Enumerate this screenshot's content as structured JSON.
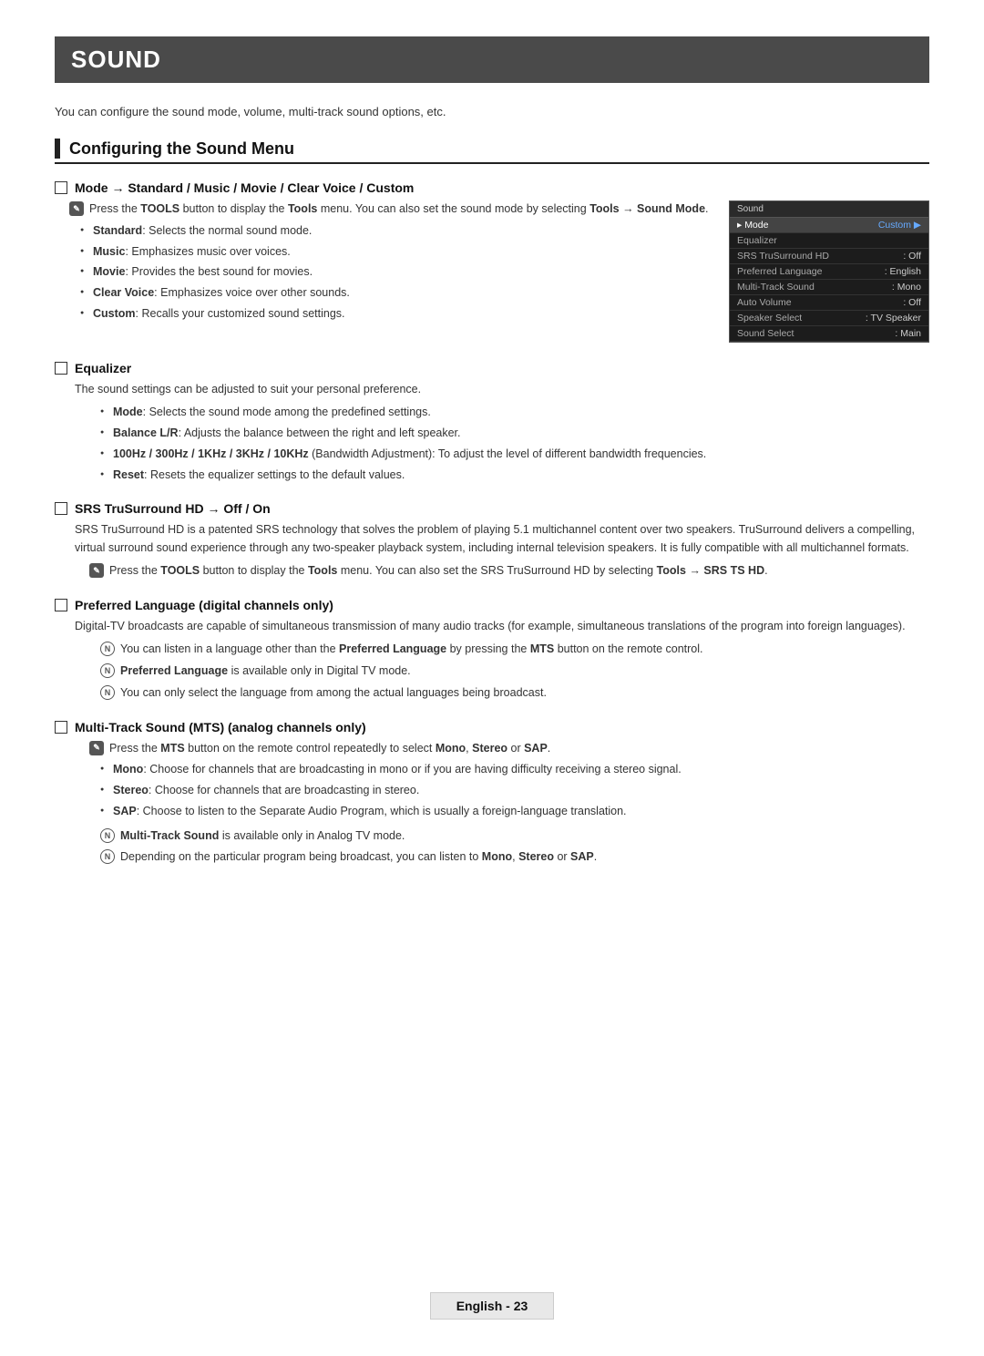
{
  "page": {
    "title": "SOUND",
    "intro": "You can configure the sound mode, volume, multi-track sound options, etc.",
    "section_title": "Configuring the Sound Menu",
    "footer_label": "English - 23"
  },
  "subsections": [
    {
      "id": "mode",
      "title": "Mode → Standard / Music / Movie / Clear Voice / Custom",
      "note1": "Press the TOOLS button to display the Tools menu. You can also set the sound mode by selecting Tools → Sound Mode.",
      "bullets": [
        "Standard: Selects the normal sound mode.",
        "Music: Emphasizes music over voices.",
        "Movie: Provides the best sound for movies.",
        "Clear Voice: Emphasizes voice over other sounds.",
        "Custom: Recalls your customized sound settings."
      ]
    },
    {
      "id": "equalizer",
      "title": "Equalizer",
      "body": "The sound settings can be adjusted to suit your personal preference.",
      "bullets": [
        "Mode: Selects the sound mode among the predefined settings.",
        "Balance L/R: Adjusts the balance between the right and left speaker.",
        "100Hz / 300Hz / 1KHz / 3KHz / 10KHz (Bandwidth Adjustment): To adjust the level of different bandwidth frequencies.",
        "Reset: Resets the equalizer settings to the default values."
      ]
    },
    {
      "id": "srs",
      "title": "SRS TruSurround HD → Off / On",
      "body1": "SRS TruSurround HD is a patented SRS technology that solves the problem of playing 5.1 multichannel content over two speakers. TruSurround delivers a compelling, virtual surround sound experience through any two-speaker playback system, including internal television speakers. It is fully compatible with all multichannel formats.",
      "note1": "Press the TOOLS button to display the Tools menu. You can also set the SRS TruSurround HD by selecting Tools → SRS TS HD."
    },
    {
      "id": "preferred_language",
      "title": "Preferred Language (digital channels only)",
      "body": "Digital-TV broadcasts are capable of simultaneous transmission of many audio tracks (for example, simultaneous translations of the program into foreign languages).",
      "notes": [
        "You can listen in a language other than the Preferred Language by pressing the MTS button on the remote control.",
        "Preferred Language is available only in Digital TV mode.",
        "You can only select the language from among the actual languages being broadcast."
      ]
    },
    {
      "id": "mts",
      "title": "Multi-Track Sound (MTS) (analog channels only)",
      "note1": "Press the MTS button on the remote control repeatedly to select Mono, Stereo or SAP.",
      "bullets": [
        "Mono: Choose for channels that are broadcasting in mono or if you are having difficulty receiving a stereo signal.",
        "Stereo: Choose for channels that are broadcasting in stereo.",
        "SAP: Choose to listen to the Separate Audio Program, which is usually a foreign-language translation."
      ],
      "notes2": [
        "Multi-Track Sound is available only in Analog TV mode.",
        "Depending on the particular program being broadcast, you can listen to Mono, Stereo or SAP."
      ]
    }
  ],
  "tv_menu": {
    "title": "Sound",
    "rows": [
      {
        "label": "▸ Mode",
        "value": "Custom ▶",
        "active": true
      },
      {
        "label": "Equalizer",
        "value": ""
      },
      {
        "label": "SRS TruSurround HD",
        "value": ": Off"
      },
      {
        "label": "Preferred Language",
        "value": ": English"
      },
      {
        "label": "Multi-Track Sound",
        "value": ": Mono"
      },
      {
        "label": "Auto Volume",
        "value": ": Off"
      },
      {
        "label": "Speaker Select",
        "value": ": TV Speaker"
      },
      {
        "label": "Sound Select",
        "value": ": Main"
      }
    ]
  }
}
